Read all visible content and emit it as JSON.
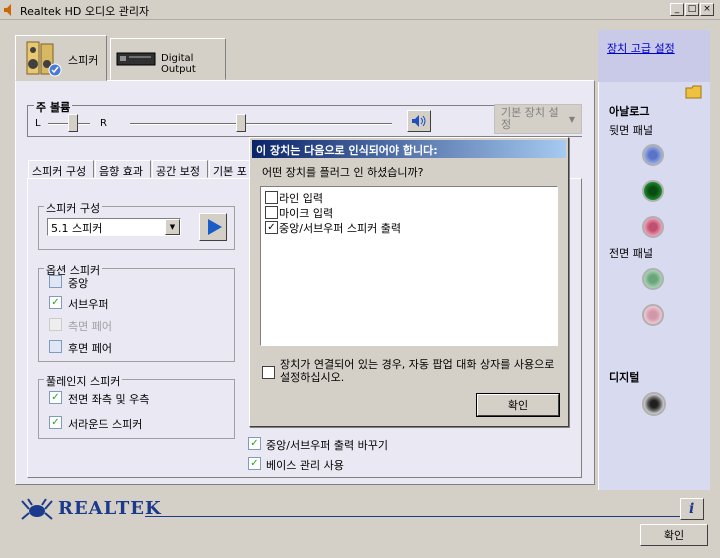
{
  "window": {
    "title": "Realtek HD 오디오 관리자",
    "minimize": "_",
    "maximize": "□",
    "close": "×"
  },
  "device_tabs": [
    {
      "label": "스피커",
      "icon": "speaker-icon",
      "active": true
    },
    {
      "label": "Digital Output",
      "icon": "digital-output-icon",
      "active": false
    }
  ],
  "right_panel": {
    "advanced_link": "장치 고급 설정",
    "analog_title": "아날로그",
    "rear_panel": "뒷면 패널",
    "front_panel": "전면 패널",
    "digital_title": "디지털",
    "jack_colors": {
      "rear_blue": "#7a93d6",
      "rear_green": "#1a8a2a",
      "rear_pink": "#e08aa0",
      "front_green": "#8ac49a",
      "front_pink": "#e8b8c8"
    }
  },
  "volume": {
    "title": "주 볼륨",
    "left": "L",
    "right": "R",
    "default_device": "기본 장치 설정"
  },
  "inner_tabs": [
    "스피커 구성",
    "음향 효과",
    "공간 보정",
    "기본 포"
  ],
  "speaker_config": {
    "group_title": "스피커 구성",
    "selected": "5.1 스피커"
  },
  "optional_speakers": {
    "title": "옵션 스피커",
    "items": [
      {
        "label": "중앙",
        "checked": false,
        "disabled": false
      },
      {
        "label": "서브우퍼",
        "checked": true,
        "disabled": false
      },
      {
        "label": "측면 페어",
        "checked": false,
        "disabled": true
      },
      {
        "label": "후면 페어",
        "checked": false,
        "disabled": false
      }
    ]
  },
  "fullrange": {
    "title": "풀레인지 스피커",
    "items": [
      {
        "label": "전면 좌측 및 우측",
        "checked": true
      },
      {
        "label": "서라운드 스피커",
        "checked": true
      }
    ]
  },
  "bottom_options": [
    {
      "label": "중앙/서브우퍼 출력 바꾸기",
      "checked": true
    },
    {
      "label": "베이스 관리 사용",
      "checked": true
    }
  ],
  "dialog": {
    "title": "이 장치는 다음으로 인식되어야 합니다:",
    "question": "어떤 장치를 플러그 인 하셨습니까?",
    "options": [
      {
        "label": "라인 입력",
        "checked": false
      },
      {
        "label": "마이크 입력",
        "checked": false
      },
      {
        "label": "중앙/서브우퍼 스피커 출력",
        "checked": true
      }
    ],
    "auto_popup": "장치가 연결되어 있는 경우, 자동 팝업 대화 상자를 사용으로 설정하십시오.",
    "auto_popup_checked": false,
    "ok": "확인"
  },
  "footer": {
    "brand": "REALTEK",
    "info": "i",
    "ok": "확인"
  },
  "check_mark": "✓"
}
